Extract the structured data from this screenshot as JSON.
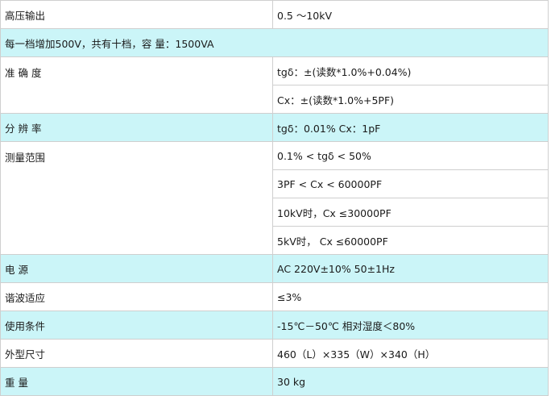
{
  "spec_table": {
    "rows": [
      {
        "label": "高压输出",
        "values": [
          "0.5 ～10kV"
        ],
        "bg": "#ffffff"
      },
      {
        "full_row": "每一档增加500V，共有十档，容 量：1500VA",
        "bg": "#cbf5f8"
      },
      {
        "label": "准 确 度",
        "values": [
          "tgδ：±(读数*1.0%+0.04%)",
          "Cx：±(读数*1.0%+5PF)"
        ],
        "bg": "#ffffff"
      },
      {
        "label": "分 辨 率",
        "values": [
          "tgδ：0.01% Cx：1pF"
        ],
        "bg": "#cbf5f8"
      },
      {
        "label": "测量范围",
        "values": [
          "0.1% < tgδ < 50%",
          "3PF < Cx < 60000PF",
          "10kV时，Cx ≤30000PF",
          "5kV时， Cx ≤60000PF"
        ],
        "bg": "#ffffff"
      },
      {
        "label": "电 源",
        "values": [
          "AC 220V±10% 50±1Hz"
        ],
        "bg": "#cbf5f8"
      },
      {
        "label": "谐波适应",
        "values": [
          "≤3%"
        ],
        "bg": "#ffffff"
      },
      {
        "label": "使用条件",
        "values": [
          "-15℃－50℃ 相对湿度＜80%"
        ],
        "bg": "#cbf5f8"
      },
      {
        "label": "外型尺寸",
        "values": [
          "460（L）×335（W）×340（H）"
        ],
        "bg": "#ffffff"
      },
      {
        "label": "重 量",
        "values": [
          "30 kg"
        ],
        "bg": "#cbf5f8"
      }
    ]
  }
}
